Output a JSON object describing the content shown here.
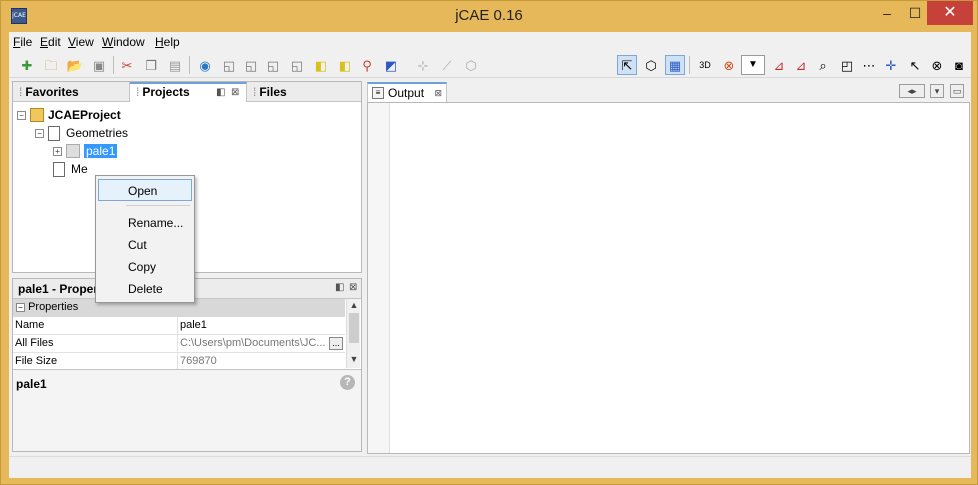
{
  "window": {
    "title": "jCAE 0.16",
    "app_icon_text": "jCAE",
    "minimize_glyph": "–",
    "maximize_glyph": "☐",
    "close_glyph": "✕"
  },
  "menubar": {
    "items": [
      {
        "label": "File",
        "mnemonic": "F",
        "rest": "ile"
      },
      {
        "label": "Edit",
        "mnemonic": "E",
        "rest": "dit"
      },
      {
        "label": "View",
        "mnemonic": "V",
        "rest": "iew"
      },
      {
        "label": "Window",
        "mnemonic": "W",
        "rest": "indow"
      },
      {
        "label": "Help",
        "mnemonic": "H",
        "rest": "elp"
      }
    ]
  },
  "toolbar": {
    "combo_glyph": "▼"
  },
  "projects_panel": {
    "tabs": [
      {
        "label": "Favorites"
      },
      {
        "label": "Projects"
      },
      {
        "label": "Files"
      }
    ],
    "minimize_glyph": "◧",
    "close_glyph": "⊠",
    "tree": {
      "root": "JCAEProject",
      "geometries": "Geometries",
      "selected_node": "pale1",
      "meshes_partial": "Me"
    }
  },
  "context_menu": {
    "items": [
      {
        "label": "Open"
      },
      {
        "label": "Rename..."
      },
      {
        "label": "Cut"
      },
      {
        "label": "Copy"
      },
      {
        "label": "Delete"
      }
    ]
  },
  "properties_panel": {
    "title": "pale1 - Properties",
    "section": "Properties",
    "rows": [
      {
        "name": "Name",
        "value": "pale1"
      },
      {
        "name": "All Files",
        "value": "C:\\Users\\pm\\Documents\\JC..."
      },
      {
        "name": "File Size",
        "value": "769870"
      }
    ],
    "ellipsis": "...",
    "description_title": "pale1",
    "help_glyph": "?"
  },
  "output_panel": {
    "tab_label": "Output",
    "close_glyph": "⊠"
  }
}
